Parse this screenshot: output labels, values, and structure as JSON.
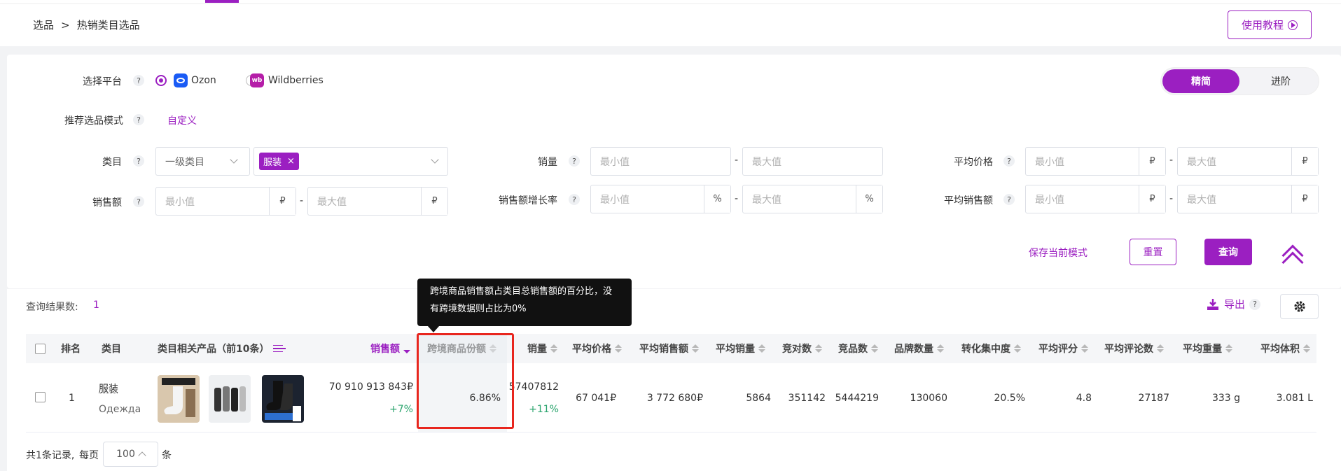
{
  "breadcrumb": {
    "root": "选品",
    "sep": ">",
    "current": "热销类目选品"
  },
  "header": {
    "tutorial_label": "使用教程"
  },
  "filters": {
    "platform": {
      "label": "选择平台",
      "options": [
        "Ozon",
        "Wildberries"
      ],
      "selected": "Ozon"
    },
    "mode": {
      "label": "推荐选品模式",
      "value": "自定义"
    },
    "view_toggle": {
      "simple": "精简",
      "advanced": "进阶",
      "active": "精简"
    },
    "category": {
      "label": "类目",
      "level_placeholder": "一级类目",
      "tag": "服装"
    },
    "sales_volume": {
      "label": "销量"
    },
    "avg_price": {
      "label": "平均价格"
    },
    "sales_amount": {
      "label": "销售额"
    },
    "sales_growth": {
      "label": "销售额增长率"
    },
    "avg_sales_amount": {
      "label": "平均销售额"
    },
    "min_placeholder": "最小值",
    "max_placeholder": "最大值",
    "currency": "₽",
    "percent": "%",
    "dash": "-",
    "help": "?",
    "save_mode": "保存当前模式",
    "reset": "重置",
    "query": "查询"
  },
  "results": {
    "count_label": "查询结果数:",
    "count": "1",
    "export": "导出",
    "tooltip": "跨境商品销售额占类目总销售额的百分比，没有跨境数据则占比为0%",
    "columns": [
      "排名",
      "类目",
      "类目相关产品（前10条）",
      "销售额",
      "跨境商品份额",
      "销量",
      "平均价格",
      "平均销售额",
      "平均销量",
      "竞对数",
      "竞品数",
      "品牌数量",
      "转化集中度",
      "平均评分",
      "平均评论数",
      "平均重量",
      "平均体积"
    ],
    "rows": [
      {
        "rank": "1",
        "category": "服装",
        "category_ru": "Одежда",
        "sales_amount": "70 910 913 843₽",
        "sales_amount_growth": "+7%",
        "cross_border_share": "6.86%",
        "sales_volume": "57407812",
        "sales_volume_growth": "+11%",
        "avg_price": "67 041₽",
        "avg_sales_amount": "3 772 680₽",
        "avg_sales_volume": "5864",
        "competitors": "351142",
        "competing_products": "5444219",
        "brands": "130060",
        "conversion_concentration": "20.5%",
        "avg_rating": "4.8",
        "avg_reviews": "27187",
        "avg_weight": "333 g",
        "avg_volume": "3.081 L"
      }
    ],
    "pager": {
      "total": "共1条记录,",
      "per_page": "每页",
      "size": "100",
      "unit": "条"
    }
  },
  "colors": {
    "accent": "#9b1fc1",
    "highlight": "#e8261e",
    "positive": "#2aa46d"
  }
}
